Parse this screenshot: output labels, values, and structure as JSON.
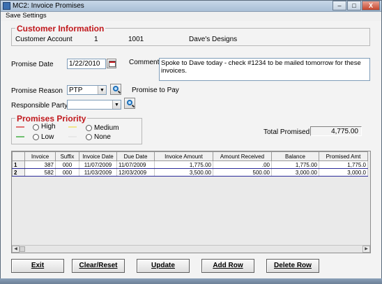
{
  "window": {
    "title": "MC2: Invoice Promises",
    "controls": [
      "–",
      "□",
      "X"
    ]
  },
  "menu": {
    "items": [
      "Save Settings"
    ]
  },
  "customer_info": {
    "title": "Customer Information",
    "label": "Customer Account",
    "number": "1",
    "account": "1001",
    "name": "Dave's Designs"
  },
  "promise": {
    "date_label": "Promise Date",
    "date_value": "1/22/2010",
    "comment_label": "Comment",
    "comment_value": "Spoke to Dave today -  check #1234 to be mailed tomorrow for these invoices.",
    "reason_label": "Promise Reason",
    "reason_value": "PTP",
    "reason_desc": "Promise to Pay",
    "party_label": "Responsible Party",
    "party_value": ""
  },
  "priority": {
    "title": "Promises Priority",
    "options": [
      {
        "label": "High",
        "color": "#e07070"
      },
      {
        "label": "Medium",
        "color": "#f0e68c"
      },
      {
        "label": "Low",
        "color": "#70c070"
      },
      {
        "label": "None",
        "color": "#e8e8e8"
      }
    ]
  },
  "total": {
    "label": "Total Promised",
    "value": "4,775.00"
  },
  "grid": {
    "columns": [
      "",
      "Invoice",
      "Suffix",
      "Invoice Date",
      "Due Date",
      "Invoice Amount",
      "Amount Received",
      "Balance",
      "Promised Amt"
    ],
    "rows": [
      [
        "1",
        "387",
        "000",
        "11/07/2009",
        "11/07/2009",
        "1,775.00",
        ".00",
        "1,775.00",
        "1,775.0"
      ],
      [
        "2",
        "582",
        "000",
        "11/03/2009",
        "12/03/2009",
        "3,500.00",
        "500.00",
        "3,000.00",
        "3,000.0"
      ]
    ]
  },
  "buttons": {
    "exit": "Exit",
    "clear": "Clear/Reset",
    "update": "Update",
    "add_row": "Add Row",
    "delete_row": "Delete Row"
  }
}
